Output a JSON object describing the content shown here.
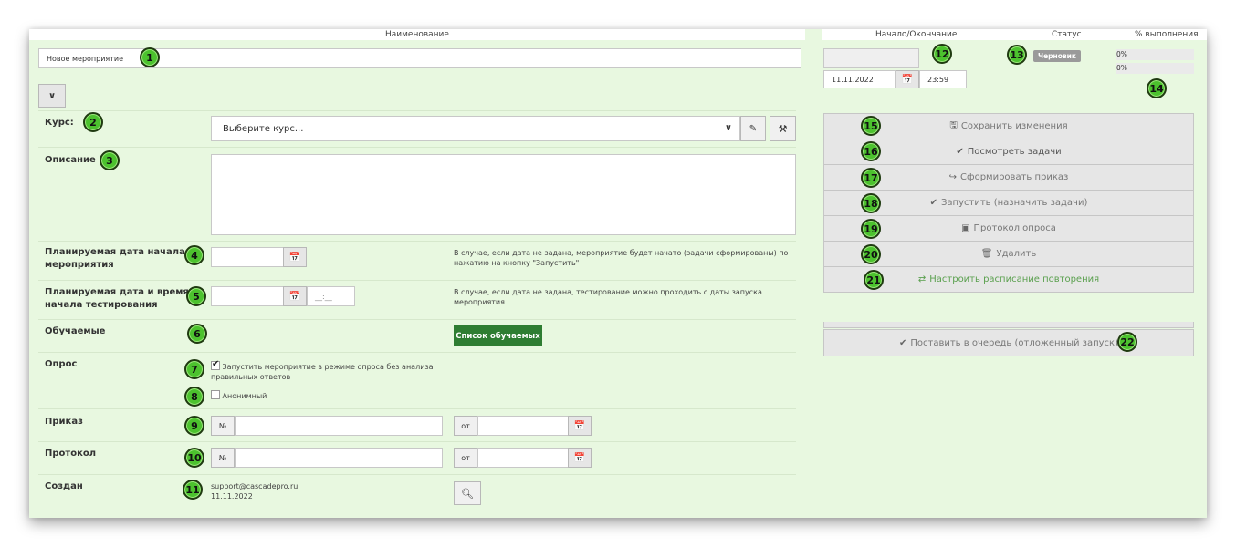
{
  "header": {
    "name": "Наименование",
    "start_end": "Начало/Окончание",
    "status": "Статус",
    "percent": "% выполнения"
  },
  "event_name": {
    "value": "Новое мероприятие"
  },
  "badges": [
    "1",
    "2",
    "3",
    "4",
    "5",
    "6",
    "7",
    "8",
    "9",
    "10",
    "11",
    "12",
    "13",
    "14",
    "15",
    "16",
    "17",
    "18",
    "19",
    "20",
    "21",
    "22"
  ],
  "course": {
    "label": "Курс:",
    "placeholder": "Выберите курс...",
    "edit_icon": "edit-icon",
    "wrench_icon": "wrench-icon"
  },
  "description": {
    "label": "Описание"
  },
  "planned_start": {
    "label_line1": "Планируемая дата начала",
    "label_line2": "мероприятия",
    "hint_line1": "В случае, если дата не задана, мероприятие будет начато (задачи сформированы) по",
    "hint_line2": "нажатию на кнопку \"Запустить\""
  },
  "testing_start": {
    "label_line1": "Планируемая дата и время",
    "label_line2": "начала тестирования",
    "time_placeholder": "__:__",
    "hint_line1": "В случае, если дата не задана, тестирование можно проходить с даты запуска",
    "hint_line2": "мероприятия"
  },
  "trainees": {
    "label": "Обучаемые",
    "button": "Список обучаемых"
  },
  "survey": {
    "label": "Опрос",
    "option1_line1": "Запустить мероприятие в режиме опроса без анализа",
    "option1_line2": "правильных ответов",
    "option1_checked": true,
    "option2": "Анонимный",
    "option2_checked": false
  },
  "order": {
    "label": "Приказ",
    "num_prefix": "№",
    "from_prefix": "от"
  },
  "protocol": {
    "label": "Протокол",
    "num_prefix": "№",
    "from_prefix": "от"
  },
  "created": {
    "label": "Создан",
    "email": "support@cascadepro.ru",
    "date": "11.11.2022"
  },
  "dates": {
    "end_date": "11.11.2022",
    "end_time": "23:59"
  },
  "status": {
    "value": "Черновик",
    "color": "#9a9a9a"
  },
  "progress": {
    "value1": "0%",
    "value2": "0%"
  },
  "actions": {
    "save": "Сохранить изменения",
    "view_tasks": "Посмотреть задачи",
    "make_order": "Сформировать приказ",
    "launch": "Запустить (назначить задачи)",
    "survey_protocol": "Протокол опроса",
    "delete": "Удалить",
    "schedule": "Настроить расписание повторения",
    "queue": "Поставить в очередь (отложенный запуск)"
  },
  "colors": {
    "panel_bg": "#e8f8e0",
    "primary_button": "#2e7d32",
    "badge": "#4cc22e"
  }
}
